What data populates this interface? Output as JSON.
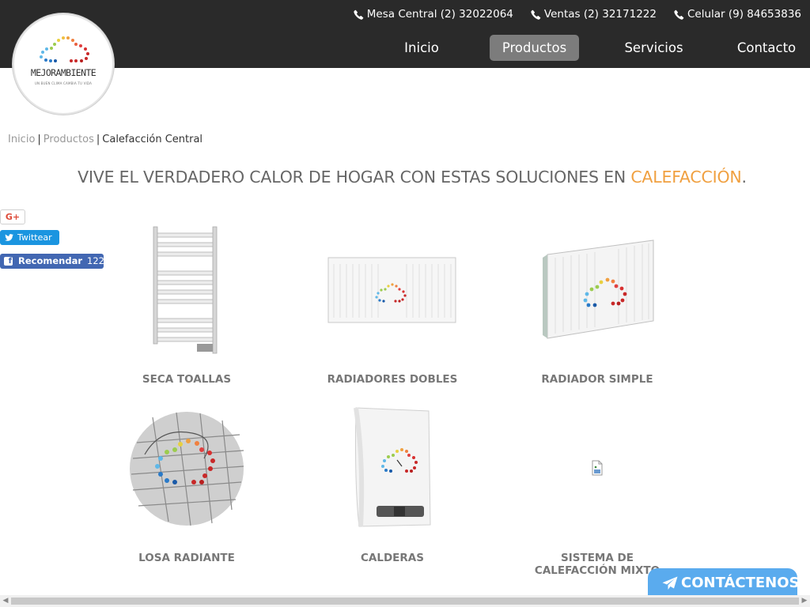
{
  "header": {
    "contacts": [
      {
        "label": "Mesa Central (2) 32022064",
        "icon": "phone-icon"
      },
      {
        "label": "Ventas (2) 32171222",
        "icon": "phone-icon"
      },
      {
        "label": "Celular (9) 84653836",
        "icon": "phone-icon"
      }
    ],
    "nav": [
      {
        "label": "Inicio",
        "active": false
      },
      {
        "label": "Productos",
        "active": true
      },
      {
        "label": "Servicios",
        "active": false
      },
      {
        "label": "Contacto",
        "active": false
      }
    ],
    "colors": {
      "bar": "#2a2a2a",
      "active_tab": "#7c7c7c"
    }
  },
  "logo": {
    "name": "MEJORAMBIENTE",
    "tagline": "UN BUEN CLIMA CAMBIA TU VIDA"
  },
  "breadcrumb": {
    "home": "Inicio",
    "section": "Productos",
    "current": "Calefacción Central"
  },
  "headline": {
    "text": "VIVE EL VERDADERO CALOR DE HOGAR CON ESTAS SOLUCIONES EN ",
    "accent": "CALEFACCIÓN",
    "end": ".",
    "accent_color": "#f0a040"
  },
  "social": {
    "gplus_label": "G+",
    "tweet_label": "Twittear",
    "recommend_label": "Recomendar",
    "recommend_count": "122"
  },
  "products": [
    {
      "label": "SECA TOALLAS",
      "image": "towel-rail-image"
    },
    {
      "label": "RADIADORES DOBLES",
      "image": "double-radiator-image"
    },
    {
      "label": "RADIADOR SIMPLE",
      "image": "single-radiator-image"
    },
    {
      "label": "LOSA RADIANTE",
      "image": "radiant-floor-image"
    },
    {
      "label": "CALDERAS",
      "image": "boiler-image"
    },
    {
      "label": "SISTEMA DE CALEFACCIÓN MIXTO",
      "image": "broken-image-icon"
    }
  ],
  "cta": {
    "label": "CONTÁCTENOS",
    "color": "#5aabee"
  }
}
